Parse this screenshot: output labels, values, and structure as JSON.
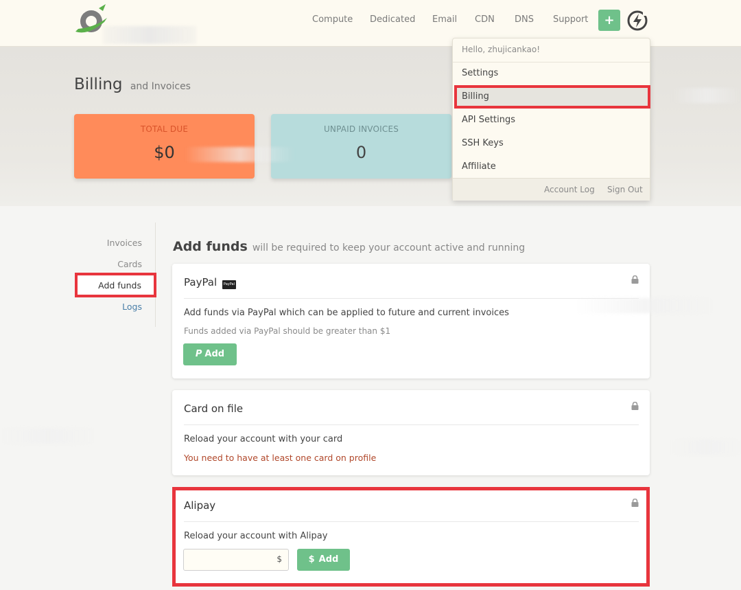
{
  "header": {
    "nav": [
      "Compute",
      "Dedicated",
      "Email",
      "CDN",
      "DNS",
      "Support"
    ],
    "plus_label": "+"
  },
  "hero": {
    "title": "Billing",
    "subtitle": "and Invoices",
    "total_due": {
      "label": "TOTAL DUE",
      "value": "$0"
    },
    "unpaid": {
      "label": "UNPAID INVOICES",
      "value": "0"
    }
  },
  "dropdown": {
    "greeting": "Hello, zhujicankao!",
    "items": [
      "Settings",
      "Billing",
      "API Settings",
      "SSH Keys",
      "Affiliate"
    ],
    "active": "Billing",
    "footer": [
      "Account Log",
      "Sign Out"
    ]
  },
  "sidebar": {
    "items": [
      "Invoices",
      "Cards",
      "Add funds",
      "Logs"
    ],
    "active": "Add funds"
  },
  "main": {
    "heading": "Add funds",
    "subheading": "will be required to keep your account active and running",
    "paypal": {
      "title": "PayPal",
      "badge": "PayPal",
      "description": "Add funds via PayPal which can be applied to future and current invoices",
      "note": "Funds added via PayPal should be greater than $1",
      "button": "Add"
    },
    "card": {
      "title": "Card on file",
      "description": "Reload your account with your card",
      "warning": "You need to have at least one card on profile"
    },
    "alipay": {
      "title": "Alipay",
      "description": "Reload your account with Alipay",
      "input_suffix": "$",
      "button": "Add"
    }
  },
  "colors": {
    "accent_green": "#6fc18a",
    "highlight_red": "#e8353d",
    "total_due_bg": "#ff8b5a",
    "unpaid_bg": "#b7dcdc"
  }
}
